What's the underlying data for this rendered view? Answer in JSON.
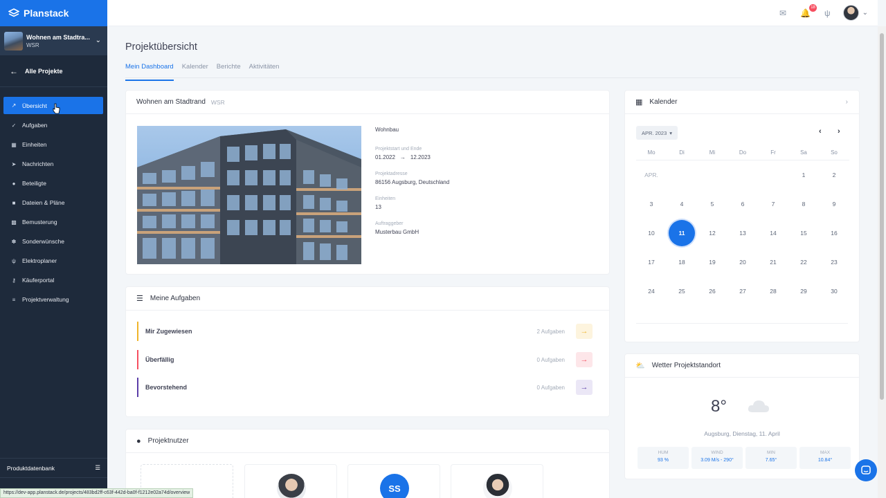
{
  "brand": {
    "name": "Planstack"
  },
  "project": {
    "name": "Wohnen am Stadtra...",
    "code": "WSR"
  },
  "sidebar": {
    "all_projects": "Alle Projekte",
    "items": [
      {
        "label": "Übersicht",
        "icon": "chart-line-icon"
      },
      {
        "label": "Aufgaben",
        "icon": "checks-icon"
      },
      {
        "label": "Einheiten",
        "icon": "building-icon"
      },
      {
        "label": "Nachrichten",
        "icon": "paper-plane-icon"
      },
      {
        "label": "Beteiligte",
        "icon": "user-icon"
      },
      {
        "label": "Dateien & Pläne",
        "icon": "file-icon"
      },
      {
        "label": "Bemusterung",
        "icon": "swatch-icon"
      },
      {
        "label": "Sonderwünsche",
        "icon": "star-icon"
      },
      {
        "label": "Elektroplaner",
        "icon": "plug-icon"
      },
      {
        "label": "Käuferportal",
        "icon": "key-icon"
      },
      {
        "label": "Projektverwaltung",
        "icon": "sliders-icon"
      }
    ],
    "bottom": "Produktdatenbank"
  },
  "topbar": {
    "notifications_count": "18"
  },
  "page": {
    "title": "Projektübersicht",
    "tabs": [
      "Mein Dashboard",
      "Kalender",
      "Berichte",
      "Aktivitäten"
    ]
  },
  "project_card": {
    "title": "Wohnen am Stadtrand",
    "code": "WSR",
    "type": "Wohnbau",
    "start_end_label": "Projektstart und Ende",
    "start": "01.2022",
    "end": "12.2023",
    "address_label": "Projektadresse",
    "address": "86156 Augsburg, Deutschland",
    "units_label": "Einheiten",
    "units": "13",
    "client_label": "Auftraggeber",
    "client": "Musterbau GmbH"
  },
  "tasks": {
    "title": "Meine Aufgaben",
    "rows": [
      {
        "name": "Mir Zugewiesen",
        "count": "2 Aufgaben",
        "color": "#f0b429",
        "bg": "#fdf4de"
      },
      {
        "name": "Überfällig",
        "count": "0 Aufgaben",
        "color": "#f64e60",
        "bg": "#fde6e9"
      },
      {
        "name": "Bevorstehend",
        "count": "0 Aufgaben",
        "color": "#5b3da8",
        "bg": "#ebe7f6"
      }
    ]
  },
  "users": {
    "title": "Projektnutzer",
    "initials": "SS"
  },
  "calendar": {
    "title": "Kalender",
    "month": "APR. 2023",
    "month_short": "APR.",
    "weekdays": [
      "Mo",
      "Di",
      "Mi",
      "Do",
      "Fr",
      "Sa",
      "So"
    ],
    "weeks": [
      [
        "APR.",
        "",
        "",
        "",
        "",
        "1",
        "2"
      ],
      [
        "3",
        "4",
        "5",
        "6",
        "7",
        "8",
        "9"
      ],
      [
        "10",
        "11",
        "12",
        "13",
        "14",
        "15",
        "16"
      ],
      [
        "17",
        "18",
        "19",
        "20",
        "21",
        "22",
        "23"
      ],
      [
        "24",
        "25",
        "26",
        "27",
        "28",
        "29",
        "30"
      ]
    ],
    "today": "11"
  },
  "weather": {
    "title": "Wetter Projektstandort",
    "temp": "8°",
    "location_date": "Augsburg, Dienstag, 11. April",
    "stats": [
      {
        "key": "HUM",
        "value": "93 %"
      },
      {
        "key": "WIND",
        "value": "3.09 M/s - 290°"
      },
      {
        "key": "MIN",
        "value": "7.65°"
      },
      {
        "key": "MAX",
        "value": "10.84°"
      }
    ]
  },
  "status_url": "https://dev-app.planstack.de/projects/483bd2ff-c63f-442d-ba0f-f1212e02a74d/overview",
  "colors": {
    "accent": "#1a73e8",
    "sidebar": "#1e2a3b"
  }
}
